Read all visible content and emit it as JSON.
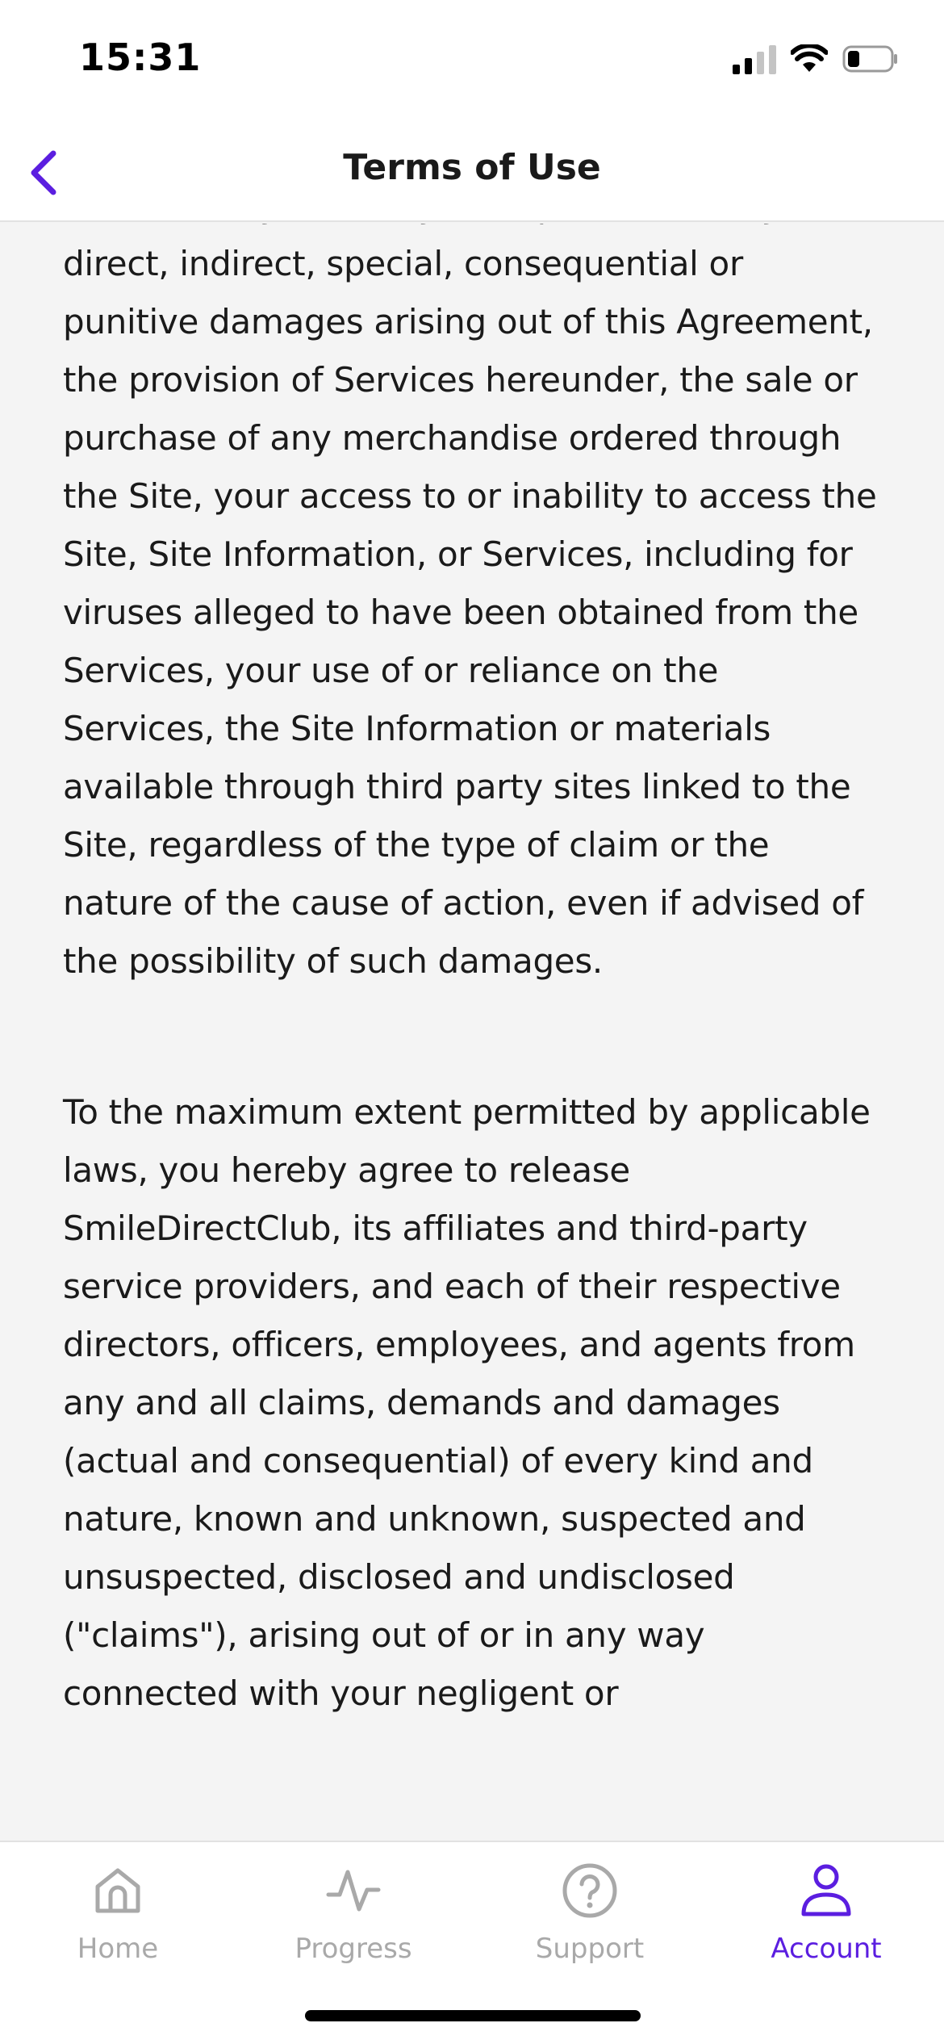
{
  "status_bar": {
    "time": "15:31"
  },
  "header": {
    "title": "Terms of Use"
  },
  "content": {
    "paragraphs": [
      "be liable to you or any third parties for any direct, indirect, special, consequential or punitive damages arising out of this Agreement, the provision of Services hereunder, the sale or purchase of any merchandise ordered through the Site, your access to or inability to access the Site, Site Information, or Services, including for viruses alleged to have been obtained from the Services, your use of or reliance on the Services, the Site Information or materials available through third party sites linked to the Site, regardless of the type of claim or the nature of the cause of action, even if advised of the possibility of such damages.",
      "To the maximum extent permitted by applicable laws, you hereby agree to release SmileDirectClub, its affiliates and third-party service providers, and each of their respective directors, officers, employees, and agents from any and all claims, demands and damages (actual and consequential) of every kind and nature, known and unknown, suspected and unsuspected, disclosed and undisclosed (\"claims\"), arising out of or in any way connected with your negligent or"
    ]
  },
  "tab_bar": {
    "tabs": [
      {
        "label": "Home",
        "icon": "home-icon",
        "active": false
      },
      {
        "label": "Progress",
        "icon": "pulse-icon",
        "active": false
      },
      {
        "label": "Support",
        "icon": "help-circle-icon",
        "active": false
      },
      {
        "label": "Account",
        "icon": "person-icon",
        "active": true
      }
    ]
  },
  "colors": {
    "accent": "#5b1ee0",
    "inactive": "#a9a9a9",
    "background": "#f4f4f4"
  }
}
